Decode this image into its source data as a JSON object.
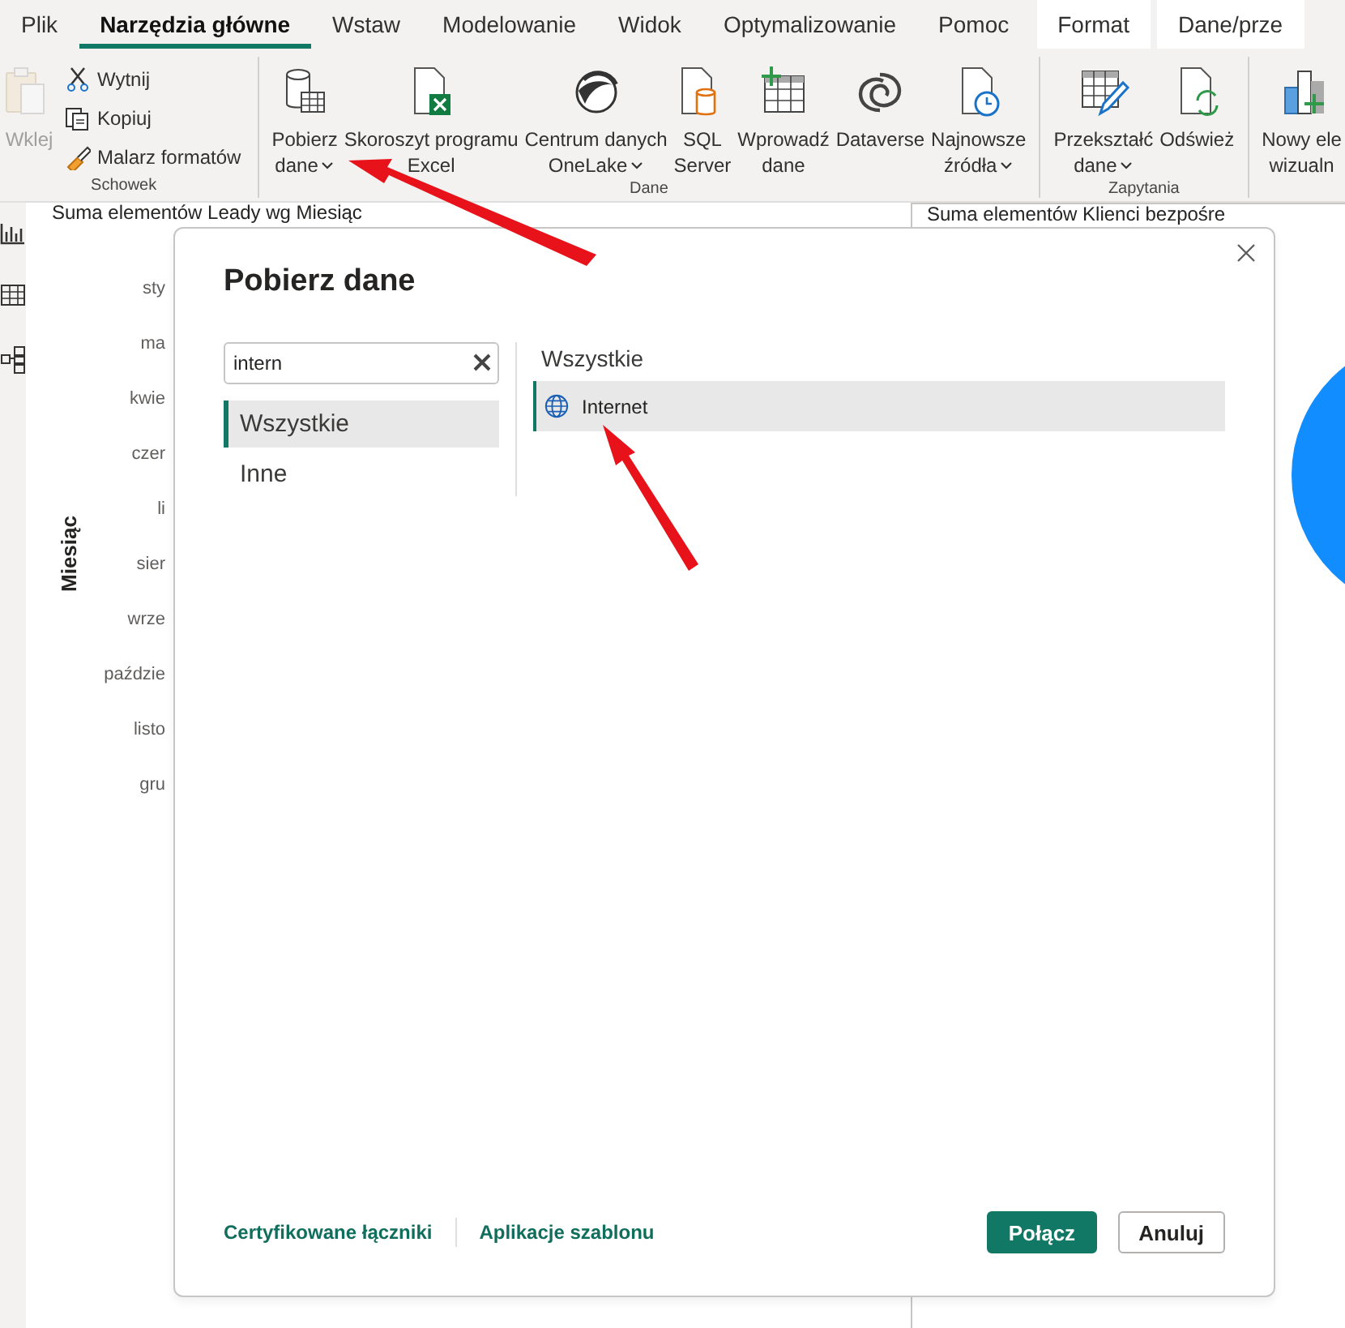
{
  "menu_tabs": [
    {
      "label": "Plik",
      "selected": false,
      "contextual": false
    },
    {
      "label": "Narzędzia główne",
      "selected": true,
      "contextual": false
    },
    {
      "label": "Wstaw",
      "selected": false,
      "contextual": false
    },
    {
      "label": "Modelowanie",
      "selected": false,
      "contextual": false
    },
    {
      "label": "Widok",
      "selected": false,
      "contextual": false
    },
    {
      "label": "Optymalizowanie",
      "selected": false,
      "contextual": false
    },
    {
      "label": "Pomoc",
      "selected": false,
      "contextual": false
    },
    {
      "label": "Format",
      "selected": false,
      "contextual": true
    },
    {
      "label": "Dane/prze",
      "selected": false,
      "contextual": true
    }
  ],
  "ribbon": {
    "groups": [
      {
        "label": "Schowek",
        "large": [
          {
            "lines": [
              "Wklej"
            ],
            "dropdown": false,
            "disabled": true
          }
        ],
        "small": [
          {
            "label": "Wytnij"
          },
          {
            "label": "Kopiuj"
          },
          {
            "label": "Malarz formatów"
          }
        ]
      },
      {
        "label": "Dane",
        "large": [
          {
            "lines": [
              "Pobierz",
              "dane"
            ],
            "dropdown": true,
            "disabled": false
          },
          {
            "lines": [
              "Skoroszyt programu",
              "Excel"
            ],
            "dropdown": false,
            "disabled": false
          },
          {
            "lines": [
              "Centrum danych",
              "OneLake"
            ],
            "dropdown": true,
            "disabled": false
          },
          {
            "lines": [
              "SQL",
              "Server"
            ],
            "dropdown": false,
            "disabled": false
          },
          {
            "lines": [
              "Wprowadź",
              "dane"
            ],
            "dropdown": false,
            "disabled": false
          },
          {
            "lines": [
              "Dataverse"
            ],
            "dropdown": false,
            "disabled": false
          },
          {
            "lines": [
              "Najnowsze",
              "źródła"
            ],
            "dropdown": true,
            "disabled": false
          }
        ]
      },
      {
        "label": "Zapytania",
        "large": [
          {
            "lines": [
              "Przekształć",
              "dane"
            ],
            "dropdown": true,
            "disabled": false
          },
          {
            "lines": [
              "Odśwież"
            ],
            "dropdown": false,
            "disabled": false
          }
        ]
      },
      {
        "large": [
          {
            "lines": [
              "Nowy ele",
              "wizualn"
            ],
            "dropdown": false,
            "disabled": false
          }
        ]
      }
    ]
  },
  "report": {
    "visuals": [
      {
        "title": "Suma elementów Leady wg Miesiąc",
        "axis_title": "Miesiąc",
        "axis_labels": [
          "sty",
          "ma",
          "kwie",
          "czer",
          "li",
          "sier",
          "wrze",
          "paździe",
          "listo",
          "gru"
        ]
      },
      {
        "title": "Suma elementów Klienci bezpośre"
      }
    ]
  },
  "dialog": {
    "title": "Pobierz dane",
    "search": {
      "value": "intern"
    },
    "categories": [
      {
        "label": "Wszystkie",
        "selected": true
      },
      {
        "label": "Inne",
        "selected": false
      }
    ],
    "results_heading": "Wszystkie",
    "results": [
      {
        "label": "Internet",
        "selected": true
      }
    ],
    "links": [
      "Certyfikowane łączniki",
      "Aplikacje szablonu"
    ],
    "buttons": [
      {
        "label": "Połącz",
        "kind": "primary"
      },
      {
        "label": "Anuluj",
        "kind": "secondary"
      }
    ]
  }
}
